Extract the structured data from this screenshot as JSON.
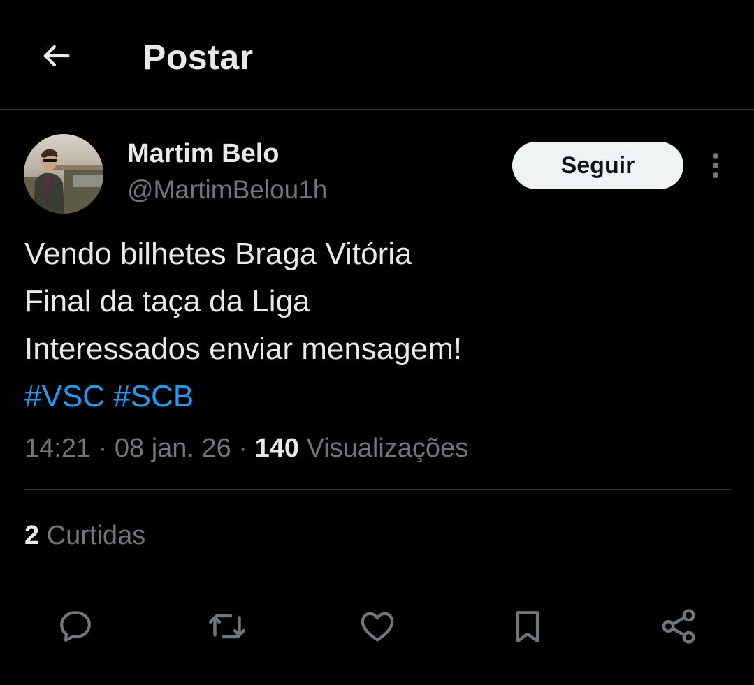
{
  "header": {
    "title": "Postar",
    "back_icon": "arrow-left-icon"
  },
  "post": {
    "author": {
      "name": "Martim Belo",
      "handle": "@MartimBelou1h"
    },
    "follow_label": "Seguir",
    "text_lines": [
      "Vendo bilhetes Braga Vitória",
      "Final da taça da Liga",
      "Interessados enviar mensagem!"
    ],
    "hashtags": [
      "#VSC",
      "#SCB"
    ],
    "time": "14:21",
    "date": "08 jan. 26",
    "separator": "·",
    "views_count": "140",
    "views_label": "Visualizações",
    "likes_count": "2",
    "likes_label": "Curtidas"
  },
  "actions": [
    {
      "icon": "reply-icon"
    },
    {
      "icon": "repost-icon"
    },
    {
      "icon": "like-icon"
    },
    {
      "icon": "bookmark-icon"
    },
    {
      "icon": "share-icon"
    }
  ],
  "colors": {
    "background": "#000000",
    "text_primary": "#e7e9ea",
    "text_secondary": "#71767b",
    "link": "#1d9bf0",
    "divider": "#2f3336",
    "follow_button_bg": "#eff3f4"
  }
}
